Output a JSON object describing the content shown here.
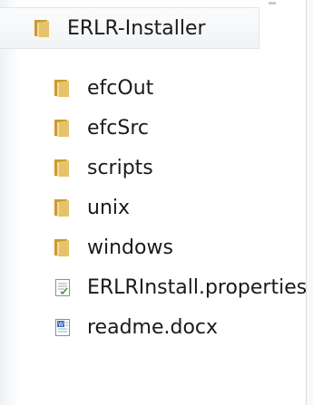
{
  "tree": {
    "root": {
      "label": "ERLR-Installer",
      "icon": "folder-icon"
    },
    "items": [
      {
        "label": "efcOut",
        "icon": "folder-icon"
      },
      {
        "label": "efcSrc",
        "icon": "folder-icon"
      },
      {
        "label": "scripts",
        "icon": "folder-icon"
      },
      {
        "label": "unix",
        "icon": "folder-icon"
      },
      {
        "label": "windows",
        "icon": "folder-icon"
      },
      {
        "label": "ERLRInstall.properties",
        "icon": "properties-file-icon"
      },
      {
        "label": "readme.docx",
        "icon": "word-document-icon"
      }
    ]
  },
  "colors": {
    "folder_front": "#e6c36a",
    "folder_back": "#c99a2e",
    "text": "#1a1a1a",
    "selection_bg": "#f1f3f5"
  }
}
